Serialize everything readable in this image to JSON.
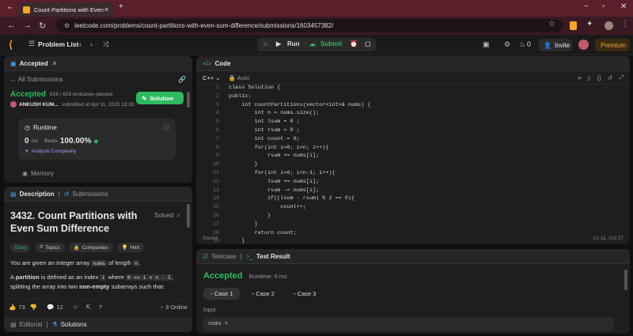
{
  "browser": {
    "tab_title": "Count Partitions with Even Sum",
    "url": "leetcode.com/problems/count-partitions-with-even-sum-difference/submissions/1603457382/"
  },
  "header": {
    "problem_list": "Problem List",
    "run": "Run",
    "submit": "Submit",
    "streak": "0",
    "invite": "Invite",
    "premium": "Premium"
  },
  "left_top": {
    "tab_accepted": "Accepted",
    "all_submissions": "All Submissions",
    "status": "Accepted",
    "testcases": "616 / 616 testcases passed",
    "user": "ANKUSH KUM...",
    "submitted": "submitted at Apr 11, 2025 13:33",
    "solution_btn": "Solution",
    "runtime_label": "Runtime",
    "runtime_value": "0",
    "runtime_unit": "ms",
    "beats_label": "Beats",
    "beats_value": "100.00%",
    "analyze": "Analyze Complexity",
    "memory_label": "Memory"
  },
  "left_bottom": {
    "tab_description": "Description",
    "tab_submissions": "Submissions",
    "title": "3432. Count Partitions with Even Sum Difference",
    "solved": "Solved",
    "tags": [
      "Easy",
      "Topics",
      "Companies",
      "Hint"
    ],
    "p1_a": "You are given an integer array",
    "p1_code1": "nums",
    "p1_b": "of length",
    "p1_code2": "n",
    "p1_c": ".",
    "p2_a": "A",
    "p2_bold": "partition",
    "p2_b": "is defined as an index",
    "p2_code1": "i",
    "p2_c": "where",
    "p2_code2": "0 <= i < n - 1",
    "p2_d": ",",
    "p3_a": "splitting the array into two",
    "p3_bold": "non-empty",
    "p3_b": "subarrays such that:",
    "likes": "73",
    "comments": "12",
    "online": "3 Online",
    "tab_editorial": "Editorial",
    "tab_solutions": "Solutions"
  },
  "code_panel": {
    "title": "Code",
    "lang": "C++",
    "auto": "Auto",
    "saved": "Saved",
    "cursor": "Ln 11, Col 27",
    "lines": [
      "class Solution {",
      "public:",
      "    int countPartitions(vector<int>& nums) {",
      "        int n = nums.size();",
      "        int lsum = 0 ;",
      "        int rsum = 0 ;",
      "        int count = 0;",
      "        for(int i=0; i<n; i++){",
      "            rsum += nums[i];",
      "        }",
      "        for(int i=0; i<n-1; i++){",
      "            lsum += nums[i];",
      "            rsum -= nums[i];",
      "            if((lsum - rsum) % 2 == 0){",
      "                count++;",
      "            }",
      "        }",
      "        return count;",
      "    }"
    ]
  },
  "result_panel": {
    "tab_testcase": "Testcase",
    "tab_result": "Test Result",
    "status": "Accepted",
    "runtime": "Runtime: 0 ms",
    "cases": [
      "Case 1",
      "Case 2",
      "Case 3"
    ],
    "input_label": "Input",
    "input_value": "nums ="
  }
}
